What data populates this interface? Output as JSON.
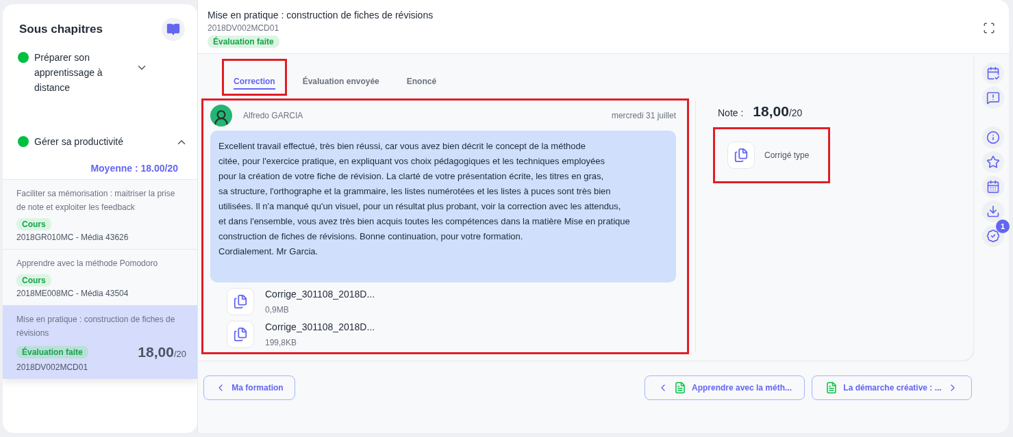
{
  "sidebar": {
    "title": "Sous chapitres",
    "chapters": [
      {
        "title": "Préparer son apprentissage à distance",
        "color": "#00c040",
        "expanded": false
      },
      {
        "title": "Gérer sa productivité",
        "color": "#00c040",
        "expanded": true,
        "average": "Moyenne : 18.00/20",
        "items": [
          {
            "title": "Faciliter sa mémorisation : maitriser la prise de note et exploiter les feedback",
            "badge": "Cours",
            "code": "2018GR010MC - Média 43626",
            "selected": false
          },
          {
            "title": "Apprendre avec la méthode Pomodoro",
            "badge": "Cours",
            "code": "2018ME008MC - Média 43504",
            "selected": false
          },
          {
            "title": "Mise en pratique : construction de fiches de révisions",
            "badge": "Évaluation faite",
            "code": "2018DV002MCD01",
            "score": "18,00",
            "score_max": "/20",
            "selected": true
          }
        ]
      }
    ]
  },
  "header": {
    "title": "Mise en pratique : construction de fiches de révisions",
    "code": "2018DV002MCD01",
    "badge": "Évaluation faite"
  },
  "tabs": [
    {
      "label": "Correction",
      "selected": true,
      "highlighted": true
    },
    {
      "label": "Évaluation envoyée",
      "selected": false,
      "highlighted": false
    },
    {
      "label": "Enoncé",
      "selected": false,
      "highlighted": false
    }
  ],
  "comment": {
    "highlighted": true,
    "author": "Alfredo GARCIA",
    "date": "mercredi 31 juillet",
    "message": "Excellent travail effectué, très bien réussi, car vous avez bien décrit le concept de la méthode\ncitée, pour l'exercice pratique, en expliquant vos choix pédagogiques et les techniques employées\npour la création de votre fiche de révision. La clarté de votre présentation écrite, les titres en gras,\nsa structure, l'orthographe et la grammaire, les listes numérotées et les listes à puces sont très bien\nutilisées. Il n'a manqué qu'un visuel, pour un résultat plus probant, voir la correction avec les attendus,\net dans l'ensemble, vous avez très bien acquis toutes les compétences dans la matière Mise en pratique\nconstruction de fiches de révisions. Bonne continuation, pour votre formation.\nCordialement. Mr Garcia.",
    "attachments": [
      {
        "name": "Corrige_301108_2018D...",
        "size": "0,9MB"
      },
      {
        "name": "Corrige_301108_2018D...",
        "size": "199,8KB"
      }
    ]
  },
  "grade": {
    "label": "Note :",
    "score": "18,00",
    "score_max": "/20"
  },
  "model_answer": {
    "label": "Corrigé type",
    "highlighted": true
  },
  "toolbar_badge": "1",
  "footer": {
    "back": "Ma formation",
    "previous": "Apprendre avec la méth...",
    "next": "La démarche créative : ..."
  }
}
